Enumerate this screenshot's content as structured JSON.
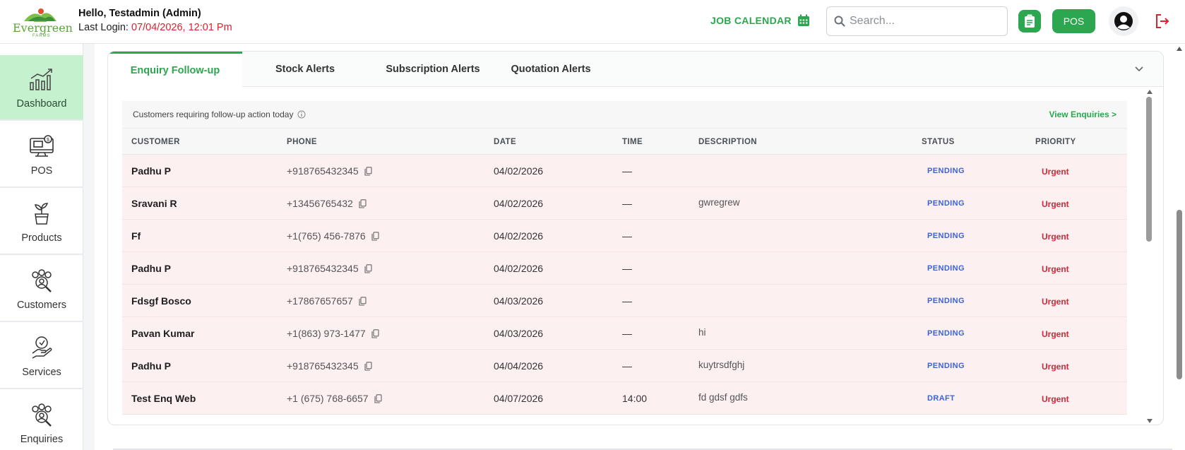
{
  "header": {
    "logo_text": "Evergreen",
    "logo_sub": "FARMS",
    "greeting": "Hello, Testadmin (Admin)",
    "last_login_label": "Last Login:",
    "last_login_value": "07/04/2026, 12:01 Pm",
    "job_calendar": "JOB CALENDAR",
    "search_placeholder": "Search...",
    "pos_label": "POS"
  },
  "sidebar": {
    "items": [
      {
        "label": "Dashboard",
        "icon": "chart-growth-icon",
        "active": true
      },
      {
        "label": "POS",
        "icon": "pos-terminal-icon",
        "active": false
      },
      {
        "label": "Products",
        "icon": "plant-pot-icon",
        "active": false
      },
      {
        "label": "Customers",
        "icon": "customers-search-icon",
        "active": false
      },
      {
        "label": "Services",
        "icon": "hand-service-icon",
        "active": false
      },
      {
        "label": "Enquiries",
        "icon": "enquiries-icon",
        "active": false
      }
    ]
  },
  "tabs": [
    {
      "label": "Enquiry Follow-up",
      "active": true
    },
    {
      "label": "Stock Alerts",
      "active": false
    },
    {
      "label": "Subscription Alerts",
      "active": false
    },
    {
      "label": "Quotation Alerts",
      "active": false
    }
  ],
  "panel": {
    "caption": "Customers requiring follow-up action today",
    "view_link": "View Enquiries >"
  },
  "table": {
    "columns": [
      "CUSTOMER",
      "PHONE",
      "DATE",
      "TIME",
      "DESCRIPTION",
      "STATUS",
      "PRIORITY"
    ],
    "rows": [
      {
        "customer": "Padhu P",
        "phone": "+918765432345",
        "date": "04/02/2026",
        "time": "—",
        "description": "",
        "status": "PENDING",
        "priority": "Urgent"
      },
      {
        "customer": "Sravani R",
        "phone": "+13456765432",
        "date": "04/02/2026",
        "time": "—",
        "description": "gwregrew",
        "status": "PENDING",
        "priority": "Urgent"
      },
      {
        "customer": "Ff",
        "phone": "+1(765) 456-7876",
        "date": "04/02/2026",
        "time": "—",
        "description": "",
        "status": "PENDING",
        "priority": "Urgent"
      },
      {
        "customer": "Padhu P",
        "phone": "+918765432345",
        "date": "04/02/2026",
        "time": "—",
        "description": "",
        "status": "PENDING",
        "priority": "Urgent"
      },
      {
        "customer": "Fdsgf Bosco",
        "phone": "+17867657657",
        "date": "04/03/2026",
        "time": "—",
        "description": "",
        "status": "PENDING",
        "priority": "Urgent"
      },
      {
        "customer": "Pavan Kumar",
        "phone": "+1(863) 973-1477",
        "date": "04/03/2026",
        "time": "—",
        "description": "hi",
        "status": "PENDING",
        "priority": "Urgent"
      },
      {
        "customer": "Padhu P",
        "phone": "+918765432345",
        "date": "04/04/2026",
        "time": "—",
        "description": "kuytrsdfghj",
        "status": "PENDING",
        "priority": "Urgent"
      },
      {
        "customer": "Test Enq Web",
        "phone": "+1 (675) 768-6657",
        "date": "04/07/2026",
        "time": "14:00",
        "description": "fd gdsf gdfs",
        "status": "DRAFT",
        "priority": "Urgent"
      }
    ]
  },
  "colors": {
    "brand_green": "#2ca64f",
    "active_sidebar": "#c6f1cf",
    "row_bg": "#fcf0f0",
    "status_blue": "#3c63d6",
    "priority_red": "#d0283a",
    "login_red": "#d9232e"
  }
}
